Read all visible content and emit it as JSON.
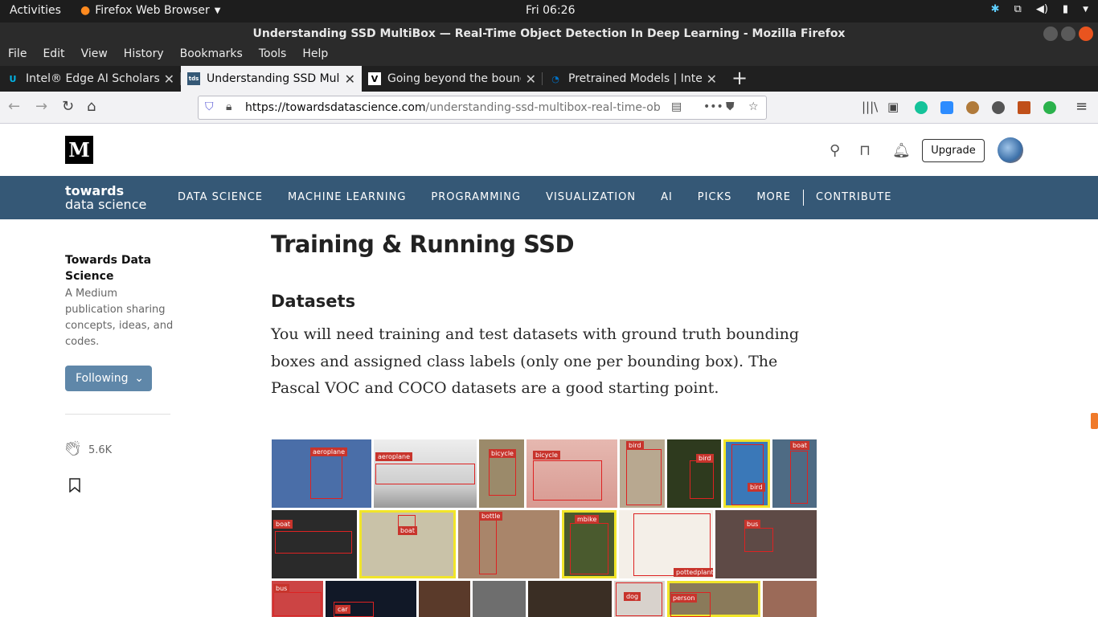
{
  "system": {
    "activities": "Activities",
    "app_name": "Firefox Web Browser",
    "clock": "Fri 06:26"
  },
  "window": {
    "title": "Understanding SSD MultiBox — Real-Time Object Detection In Deep Learning - Mozilla Firefox"
  },
  "menu": [
    "File",
    "Edit",
    "View",
    "History",
    "Bookmarks",
    "Tools",
    "Help"
  ],
  "tabs": [
    {
      "title": "Intel® Edge AI Scholarsh",
      "favicon": "udacity-icon",
      "active": false
    },
    {
      "title": "Understanding SSD Multi",
      "favicon": "tds-icon",
      "active": true
    },
    {
      "title": "Going beyond the bound",
      "favicon": "v-icon",
      "active": false
    },
    {
      "title": "Pretrained Models | Intel",
      "favicon": "intel-icon",
      "active": false
    }
  ],
  "urlbar": {
    "domain": "https://towardsdatascience.com",
    "path": "/understanding-ssd-multibox-real-time-ob"
  },
  "medium": {
    "upgrade_label": "Upgrade"
  },
  "tds": {
    "logo_line1": "towards",
    "logo_line2": "data science",
    "nav": [
      "DATA SCIENCE",
      "MACHINE LEARNING",
      "PROGRAMMING",
      "VISUALIZATION",
      "AI",
      "PICKS",
      "MORE"
    ],
    "contribute": "CONTRIBUTE"
  },
  "sidebar": {
    "pub_title": "Towards Data Science",
    "pub_desc": "A Medium publication sharing concepts, ideas, and codes.",
    "follow_label": "Following",
    "claps": "5.6K"
  },
  "article": {
    "heading": "Training & Running SSD",
    "subheading": "Datasets",
    "paragraph": "You will need training and test datasets with ground truth bounding boxes and assigned class labels (only one per bounding box). The Pascal VOC and COCO datasets are a good starting point."
  },
  "figure_labels": [
    "aeroplane",
    "aeroplane",
    "bicycle",
    "bicycle",
    "bird",
    "bird",
    "bird",
    "boat",
    "boat",
    "boat",
    "bottle",
    "mbike",
    "pottedplant",
    "bus",
    "bus",
    "car",
    "dog",
    "person"
  ],
  "colors": {
    "tds_nav": "#355876",
    "follow_button": "#5f87a9",
    "label_red": "#c8342c",
    "highlight_yellow": "#f1e52a"
  }
}
